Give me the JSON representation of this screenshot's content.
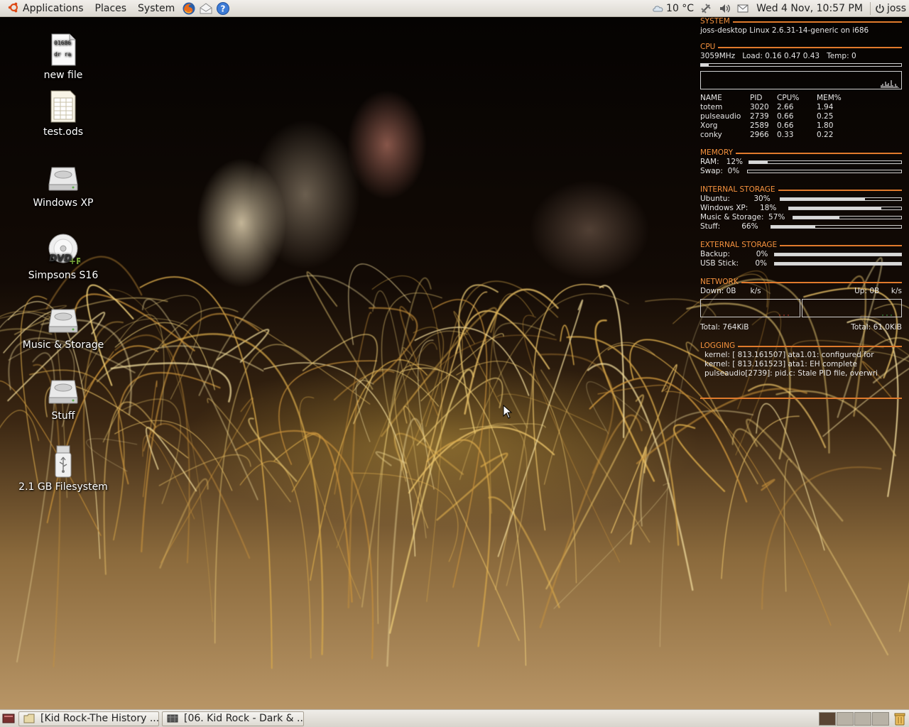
{
  "top_panel": {
    "menus": [
      "Applications",
      "Places",
      "System"
    ],
    "weather": "10 °C",
    "clock": "Wed  4 Nov, 10:57 PM",
    "user": "joss"
  },
  "desktop_icons": [
    {
      "label": "new file",
      "icon": "text-file-icon"
    },
    {
      "label": "test.ods",
      "icon": "spreadsheet-icon"
    },
    {
      "label": "Windows XP",
      "icon": "hard-drive-icon"
    },
    {
      "label": "Simpsons S16",
      "icon": "dvd-icon"
    },
    {
      "label": "Music & Storage",
      "icon": "hard-drive-icon"
    },
    {
      "label": "Stuff",
      "icon": "hard-drive-icon"
    },
    {
      "label": "2.1 GB Filesystem",
      "icon": "usb-drive-icon"
    }
  ],
  "new_file_preview": [
    "01686",
    "dr ra"
  ],
  "conky": {
    "system": {
      "head": "SYSTEM",
      "info": "joss-desktop Linux 2.6.31-14-generic on i686"
    },
    "cpu": {
      "head": "CPU",
      "info": "3059MHz   Load: 0.16 0.47 0.43   Temp: 0",
      "usage_fraction": 0.04
    },
    "processes": {
      "headers": [
        "NAME",
        "PID",
        "CPU%",
        "MEM%"
      ],
      "rows": [
        [
          "totem",
          "3020",
          "2.66",
          "1.94"
        ],
        [
          "pulseaudio",
          "2739",
          "0.66",
          "0.25"
        ],
        [
          "Xorg",
          "2589",
          "0.66",
          "1.80"
        ],
        [
          "conky",
          "2966",
          "0.33",
          "0.22"
        ]
      ]
    },
    "memory": {
      "head": "MEMORY",
      "ram_label": "RAM:   12%",
      "ram_fraction": 0.12,
      "swap_label": "Swap:  0%",
      "swap_fraction": 0.0
    },
    "internal_storage": {
      "head": "INTERNAL STORAGE",
      "items": [
        {
          "label": "Ubuntu:          30%",
          "fraction": 0.7
        },
        {
          "label": "Windows XP:     18%",
          "fraction": 0.82
        },
        {
          "label": "Music & Storage:  57%",
          "fraction": 0.43
        },
        {
          "label": "Stuff:         66%",
          "fraction": 0.34
        }
      ]
    },
    "external_storage": {
      "head": "EXTERNAL STORAGE",
      "items": [
        {
          "label": "Backup:           0%",
          "fraction": 1.0
        },
        {
          "label": "USB Stick:       0%",
          "fraction": 1.0
        }
      ]
    },
    "network": {
      "head": "NETWORK",
      "down": "Down: 0B      k/s",
      "up": "Up: 0B     k/s",
      "down_total": "Total: 764KiB",
      "up_total": "Total: 61.0KiB"
    },
    "logging": {
      "head": "LOGGING",
      "lines": [
        "kernel: [ 813.161507] ata1.01: configured for",
        "kernel: [ 813.161523] ata1: EH complete",
        "pulseaudio[2739]: pid.c: Stale PID file, overwri"
      ]
    }
  },
  "taskbar": {
    "tasks": [
      "[Kid Rock-The History ...",
      "[06. Kid Rock - Dark & ..."
    ],
    "workspaces": 4,
    "active_workspace": 0
  },
  "colors": {
    "accent": "#f5923e",
    "panel": "#e6e3dd"
  }
}
